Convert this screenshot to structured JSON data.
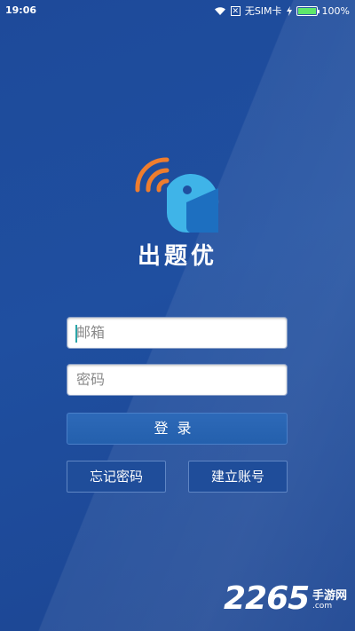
{
  "status_bar": {
    "time": "19:06",
    "carrier": "无SIM卡",
    "battery": "100%",
    "battery_level": 1.0
  },
  "app": {
    "name": "出题优",
    "colors": {
      "logo_blue": "#3fb4e8",
      "logo_dark_blue": "#1d6fc0",
      "logo_orange": "#ef7d2e",
      "background": "#1f4fa0"
    }
  },
  "login_form": {
    "email_placeholder": "邮箱",
    "password_placeholder": "密码",
    "login_label": "登录",
    "forgot_label": "忘记密码",
    "register_label": "建立账号"
  },
  "watermark": {
    "number": "2265",
    "site_name": "手游网",
    "url": ".com"
  }
}
